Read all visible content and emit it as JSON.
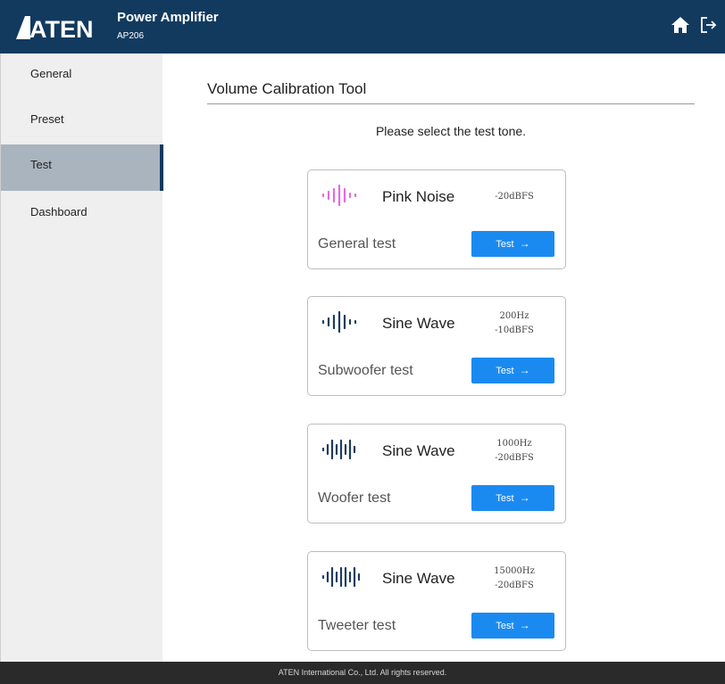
{
  "header": {
    "logo_text": "ATEN",
    "title": "Power Amplifier",
    "model": "AP206",
    "icons": [
      "home-icon",
      "logout-icon"
    ]
  },
  "sidebar": {
    "items": [
      {
        "label": "General",
        "active": false
      },
      {
        "label": "Preset",
        "active": false
      },
      {
        "label": "Test",
        "active": true
      },
      {
        "label": "Dashboard",
        "active": false
      }
    ]
  },
  "main": {
    "title": "Volume Calibration Tool",
    "prompt": "Please select the test tone.",
    "cards": [
      {
        "tone": "Pink Noise",
        "spec": [
          "-20dBFS"
        ],
        "label": "General test",
        "button": "Test",
        "wave_color": "#e46be0"
      },
      {
        "tone": "Sine Wave",
        "spec": [
          "200Hz",
          "-10dBFS"
        ],
        "label": "Subwoofer test",
        "button": "Test",
        "wave_color": "#1d3c5e"
      },
      {
        "tone": "Sine Wave",
        "spec": [
          "1000Hz",
          "-20dBFS"
        ],
        "label": "Woofer test",
        "button": "Test",
        "wave_color": "#1d3c5e"
      },
      {
        "tone": "Sine Wave",
        "spec": [
          "15000Hz",
          "-20dBFS"
        ],
        "label": "Tweeter test",
        "button": "Test",
        "wave_color": "#1d3c5e"
      }
    ]
  },
  "footer": {
    "text": "ATEN International Co., Ltd. All rights reserved."
  },
  "colors": {
    "header_bg": "#123a5f",
    "button_bg": "#1b8af0",
    "sidebar_active": "#a9b4be"
  }
}
